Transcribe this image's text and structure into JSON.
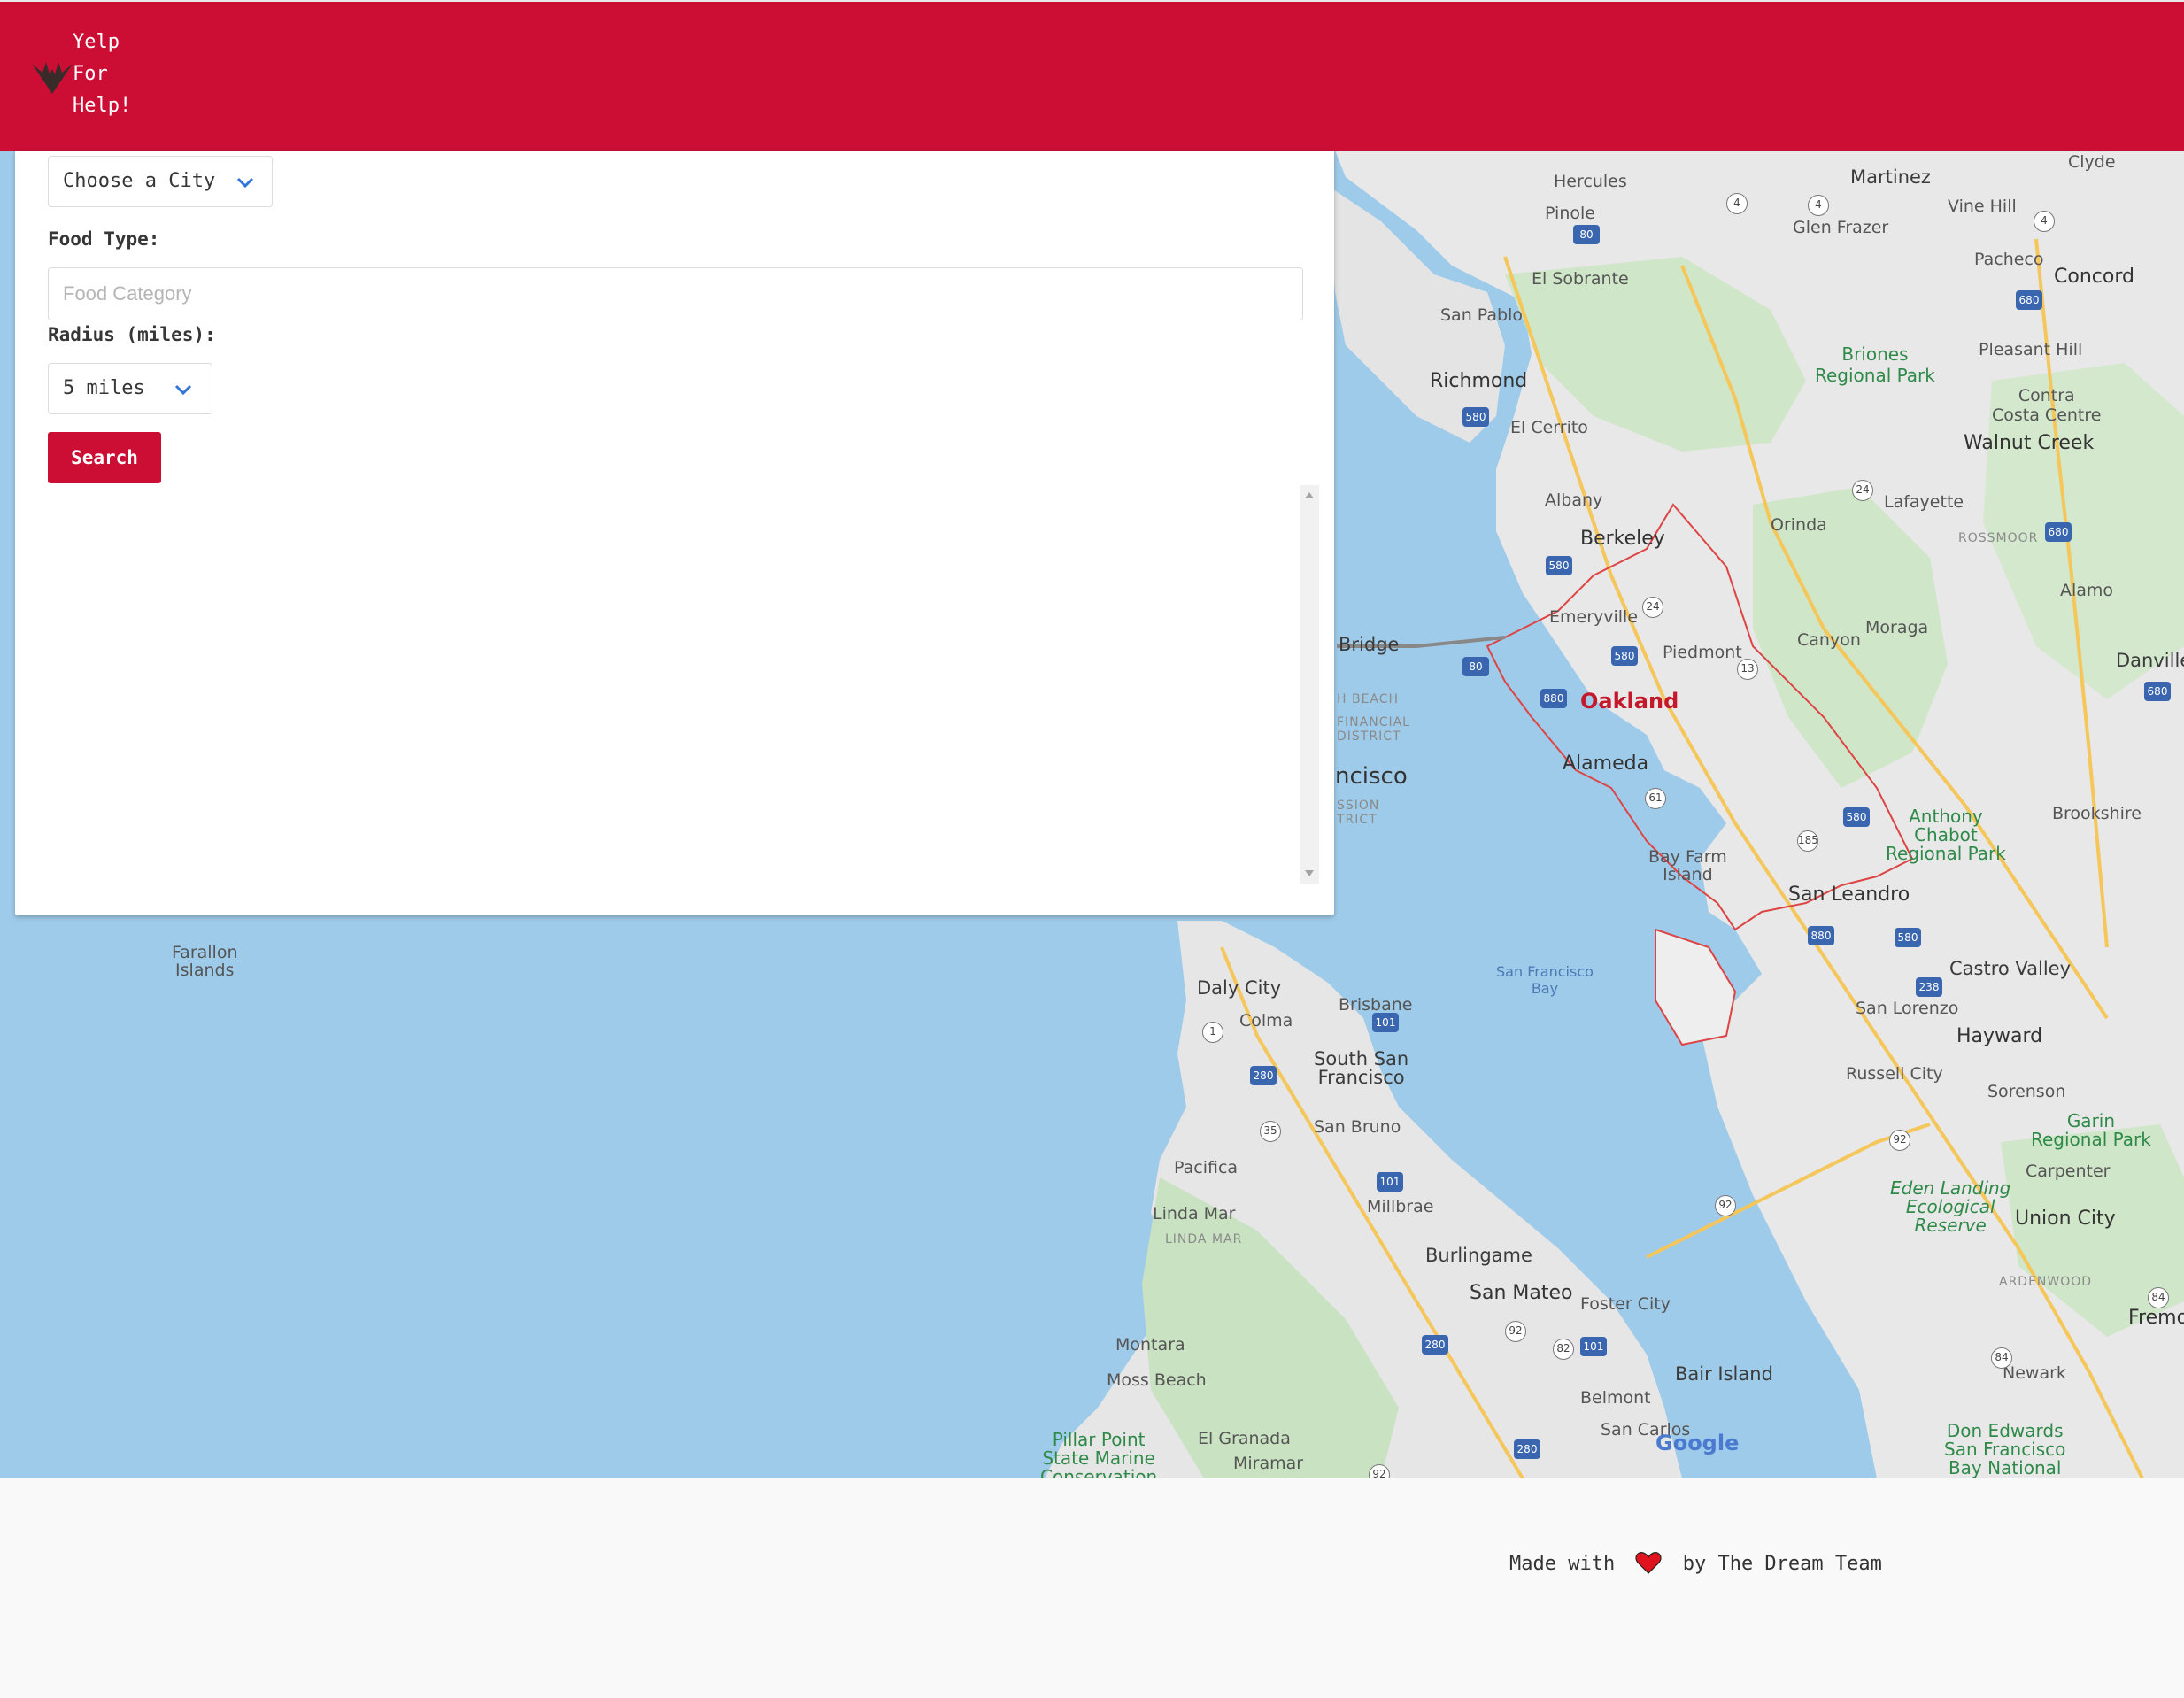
{
  "header": {
    "brand_lines": [
      "Yelp",
      "For",
      "Help!"
    ],
    "logo_icon": "bird-wings-icon",
    "background_color": "#cc0e35"
  },
  "form": {
    "city_select": {
      "value": "Choose a City"
    },
    "food_type_label": "Food Type:",
    "food_input": {
      "value": "",
      "placeholder": "Food Category"
    },
    "radius_label": "Radius (miles):",
    "radius_select": {
      "value": "5 miles"
    },
    "search_button": "Search"
  },
  "map": {
    "center_city": "Oakland",
    "labels": {
      "hercules": "Hercules",
      "martinez": "Martinez",
      "clyde": "Clyde",
      "pinole": "Pinole",
      "vine_hill": "Vine Hill",
      "glen_frazer": "Glen Frazer",
      "pacheco": "Pacheco",
      "concord": "Concord",
      "el_sobrante": "El Sobrante",
      "san_pablo": "San Pablo",
      "briones": "Briones\nRegional Park",
      "pleasant_hill": "Pleasant Hill",
      "richmond": "Richmond",
      "contra_costa": "Contra\nCosta Centre",
      "el_cerrito": "El Cerrito",
      "walnut_creek": "Walnut Creek",
      "albany": "Albany",
      "lafayette": "Lafayette",
      "orinda": "Orinda",
      "berkeley": "Berkeley",
      "rossmoor": "ROSSMOOR",
      "alamo": "Alamo",
      "emeryville": "Emeryville",
      "moraga": "Moraga",
      "canyon": "Canyon",
      "bridge": "Bridge",
      "piedmont": "Piedmont",
      "danville": "Danville",
      "oakland": "Oakland",
      "financial": "FINANCIAL\nDISTRICT",
      "beach": "H BEACH",
      "alameda": "Alameda",
      "ncisco": "ncisco",
      "mission": "SSION\nTRICT",
      "anthony": "Anthony\nChabot\nRegional Park",
      "brookshire": "Brookshire",
      "bay_farm": "Bay Farm\nIsland",
      "san_leandro": "San Leandro",
      "farallon": "Farallon\nIslands",
      "sf_bay": "San Francisco\nBay",
      "daly_city": "Daly City",
      "castro_valley": "Castro Valley",
      "brisbane": "Brisbane",
      "colma": "Colma",
      "san_lorenzo": "San Lorenzo",
      "hayward": "Hayward",
      "south_sf": "South San\nFrancisco",
      "russell_city": "Russell City",
      "sorenson": "Sorenson",
      "san_bruno": "San Bruno",
      "garin": "Garin\nRegional Park",
      "pacifica": "Pacifica",
      "carpenter": "Carpenter",
      "eden_landing": "Eden Landing\nEcological\nReserve",
      "millbrae": "Millbrae",
      "linda_mar": "Linda Mar",
      "linda_mar_d": "LINDA MAR",
      "union_city": "Union City",
      "burlingame": "Burlingame",
      "ardenwood": "ARDENWOOD",
      "san_mateo": "San Mateo",
      "foster_city": "Foster City",
      "fremont": "Fremo",
      "montara": "Montara",
      "moss_beach": "Moss Beach",
      "bair_island": "Bair Island",
      "newark": "Newark",
      "belmont": "Belmont",
      "pillar_point": "Pillar Point\nState Marine\nConservation",
      "el_granada": "El Granada",
      "san_carlos": "San Carlos",
      "miramar": "Miramar",
      "don_edwards": "Don Edwards\nSan Francisco\nBay National",
      "google": "Google"
    },
    "shields": [
      "4",
      "4",
      "4",
      "80",
      "680",
      "580",
      "24",
      "680",
      "580",
      "24",
      "580",
      "80",
      "880",
      "13",
      "61",
      "185",
      "580",
      "880",
      "580",
      "238",
      "101",
      "1",
      "280",
      "35",
      "101",
      "92",
      "92",
      "280",
      "92",
      "82",
      "101",
      "84",
      "84",
      "280",
      "680",
      "92"
    ],
    "satellite_toggle": "satellite-thumbnail"
  },
  "footer": {
    "text_before": "Made with",
    "heart_icon": "heart-icon",
    "text_after": "by The Dream Team"
  }
}
